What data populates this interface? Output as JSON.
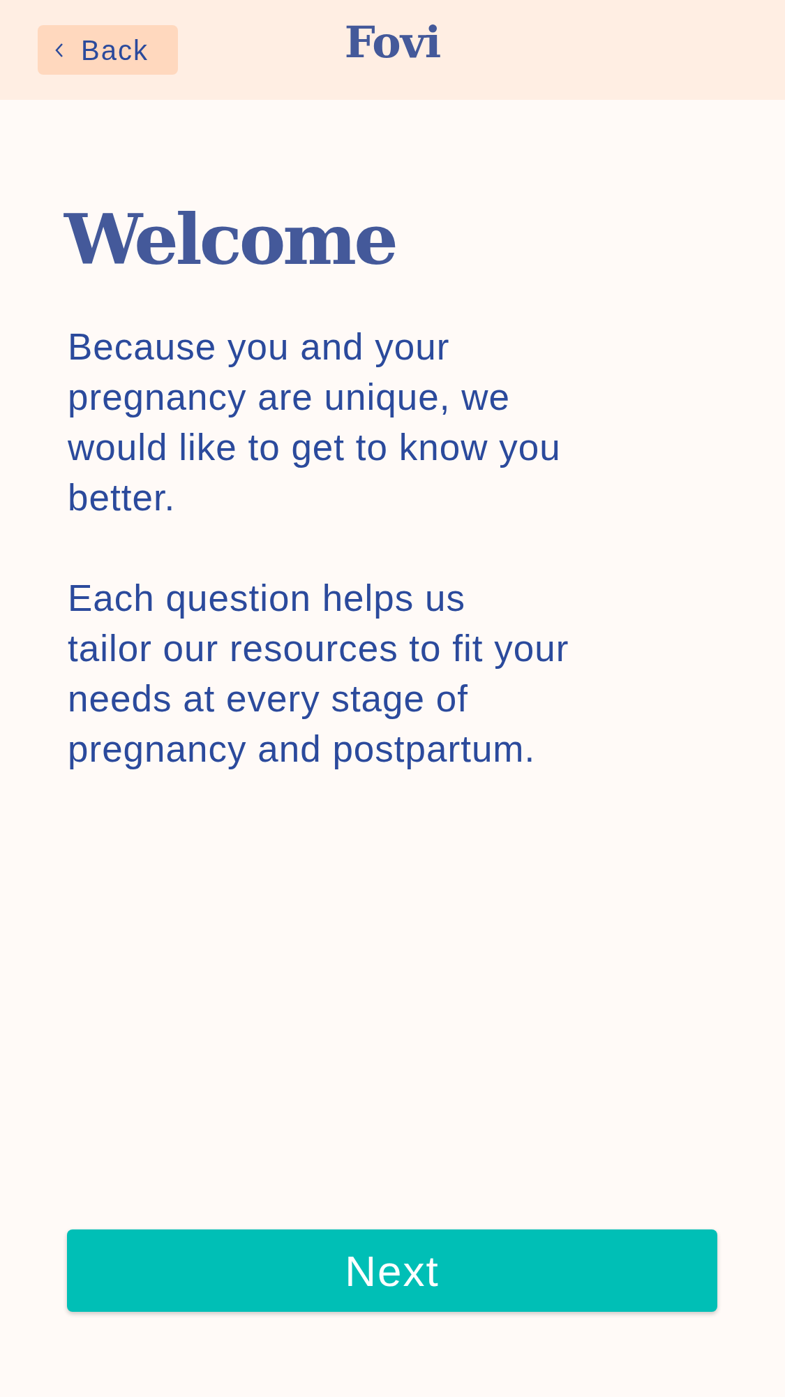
{
  "header": {
    "back_label": "Back",
    "logo": "Fovi"
  },
  "title": "Welcome",
  "paragraphs": [
    {
      "lines": [
        "Because you and your",
        "pregnancy are unique, we",
        "would like to get to know you",
        "better."
      ]
    },
    {
      "lines": [
        "Each question helps us",
        "tailor our resources to fit your",
        "needs at every stage of",
        "pregnancy and postpartum."
      ]
    }
  ],
  "next_button": "Next"
}
